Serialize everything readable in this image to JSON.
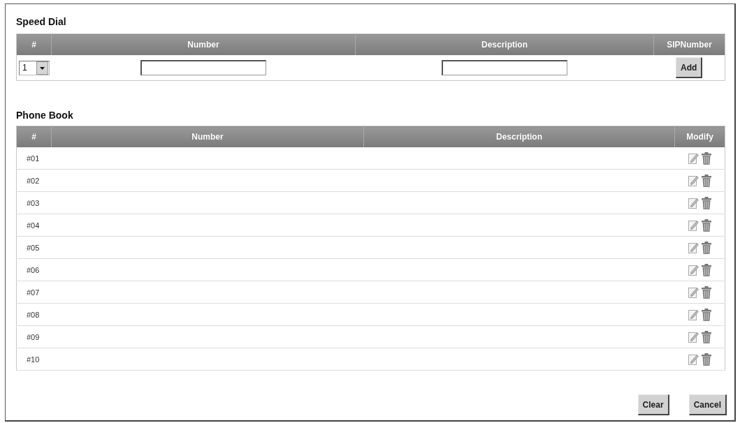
{
  "speed_dial": {
    "title": "Speed Dial",
    "columns": [
      "#",
      "Number",
      "Description",
      "SIPNumber"
    ],
    "row": [
      {
        "kind": "select",
        "value": "1"
      },
      {
        "kind": "input"
      },
      {
        "kind": "input"
      },
      {
        "kind": "button",
        "label": "Add"
      }
    ]
  },
  "phone_book": {
    "title": "Phone Book",
    "columns": [
      "#",
      "Number",
      "Description",
      "Modify"
    ],
    "rows": [
      {
        "index": "#01"
      },
      {
        "index": "#02"
      },
      {
        "index": "#03"
      },
      {
        "index": "#04"
      },
      {
        "index": "#05"
      },
      {
        "index": "#06"
      },
      {
        "index": "#07"
      },
      {
        "index": "#08"
      },
      {
        "index": "#09"
      },
      {
        "index": "#10"
      }
    ]
  },
  "buttons": [
    {
      "label": "Clear"
    },
    {
      "label": "Cancel"
    }
  ]
}
